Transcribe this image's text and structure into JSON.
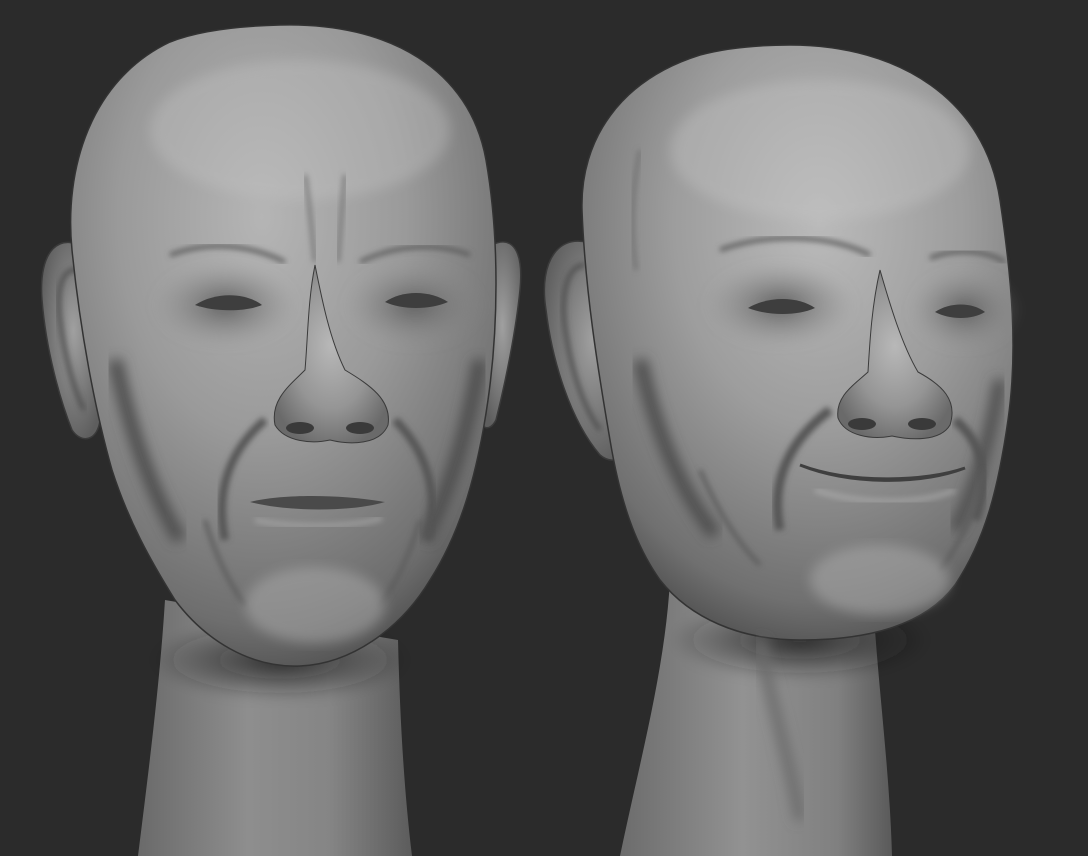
{
  "scene": {
    "background_color": "#2b2b2b",
    "clay_color": "#8c8c8c",
    "subjects": [
      {
        "id": "head-left",
        "expression": "neutral-frown"
      },
      {
        "id": "head-right",
        "expression": "smile"
      }
    ]
  }
}
